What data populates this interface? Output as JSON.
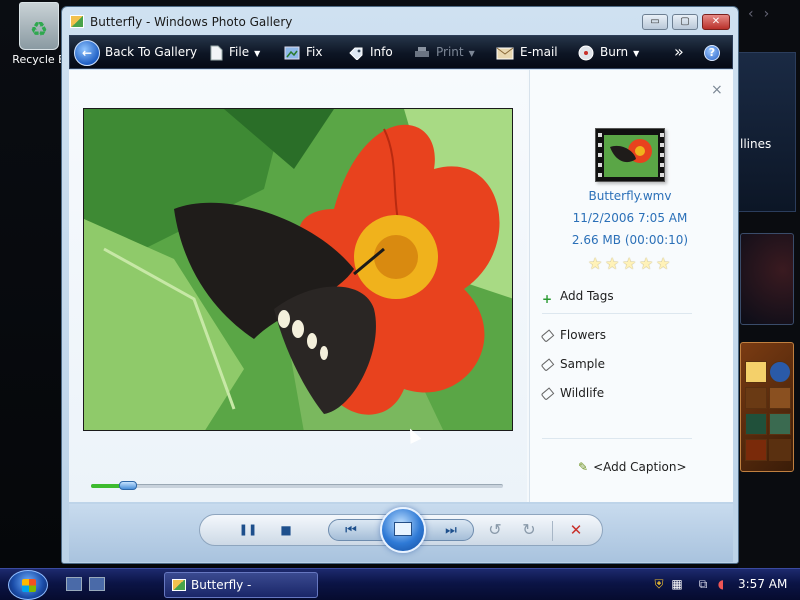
{
  "desktop": {
    "recycle_bin_label": "Recycle B",
    "news_gadget_text": "llines"
  },
  "window": {
    "title": "Butterfly - Windows Photo Gallery",
    "controls": {
      "minimize": "▭",
      "maximize": "▢",
      "close": "✕"
    }
  },
  "toolbar": {
    "back_label": "Back To Gallery",
    "file_label": "File",
    "fix_label": "Fix",
    "info_label": "Info",
    "print_label": "Print",
    "email_label": "E-mail",
    "burn_label": "Burn",
    "more_label": "»",
    "help_label": "?"
  },
  "info_pane": {
    "close_label": "×",
    "file_name": "Butterfly.wmv",
    "file_date": "11/2/2006   7:05 AM",
    "file_size": "2.66 MB (00:00:10)",
    "rating": 0,
    "rating_max": 5,
    "add_tags_label": "Add Tags",
    "tags": [
      "Flowers",
      "Sample",
      "Wildlife"
    ],
    "add_caption_label": "<Add Caption>"
  },
  "playback": {
    "progress": 0.09
  },
  "controls": {
    "pause": "❚❚",
    "stop": "■",
    "previous": "⏮",
    "next": "⏭",
    "rotate_ccw": "↺",
    "rotate_cw": "↻",
    "delete": "✕"
  },
  "taskbar": {
    "task_label": "Butterfly - Windows...",
    "clock": "3:57 AM"
  },
  "colors": {
    "toolbar_bg": "#0d1524",
    "link_blue": "#2b70b8",
    "accent_green": "#3dbb2f",
    "delete_red": "#c8302a"
  }
}
